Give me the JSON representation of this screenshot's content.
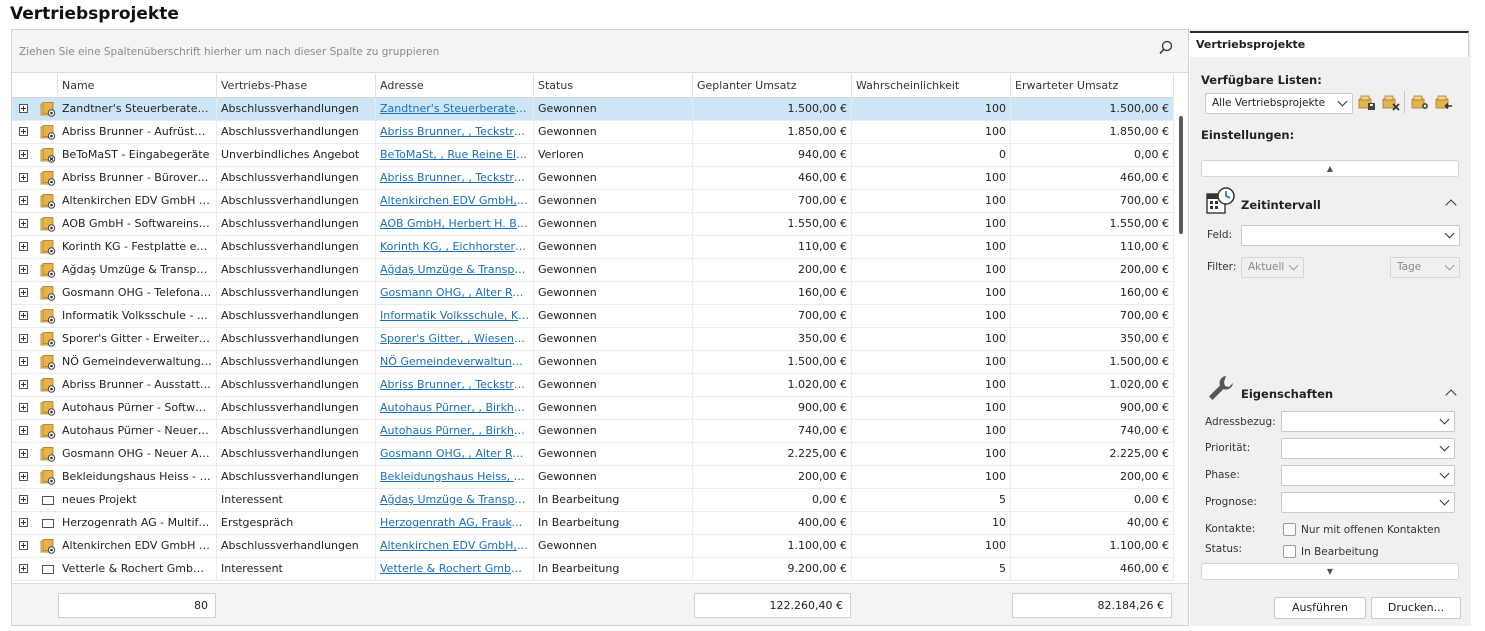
{
  "page": {
    "title": "Vertriebsprojekte"
  },
  "grid": {
    "group_hint": "Ziehen Sie eine Spaltenüberschrift hierher um nach dieser Spalte zu gruppieren",
    "columns": [
      "Name",
      "Vertriebs-Phase",
      "Adresse",
      "Status",
      "Geplanter Umsatz",
      "Wahrscheinlichkeit",
      "Erwarteter Umsatz"
    ],
    "rows": [
      {
        "icon": "project",
        "name": "Zandtner's Steuerberater - D...",
        "phase": "Abschlussverhandlungen",
        "address": "Zandtner's Steuerberater, Lé...",
        "status": "Gewonnen",
        "planned": "1.500,00 €",
        "probability": "100",
        "expected": "1.500,00 €",
        "selected": true
      },
      {
        "icon": "project",
        "name": "Abriss Brunner - Aufrüstung ...",
        "phase": "Abschlussverhandlungen",
        "address": "Abriss Brunner, , Teckstraße...",
        "status": "Gewonnen",
        "planned": "1.850,00 €",
        "probability": "100",
        "expected": "1.850,00 €"
      },
      {
        "icon": "project-lost",
        "name": "BeToMaST - Eingabegeräte",
        "phase": "Unverbindliches Angebot",
        "address": "BeToMaSt, , Rue Reine Elisa...",
        "status": "Verloren",
        "planned": "940,00 €",
        "probability": "0",
        "expected": "0,00 €"
      },
      {
        "icon": "project",
        "name": "Abriss Brunner - Bürovergröß...",
        "phase": "Abschlussverhandlungen",
        "address": "Abriss Brunner, , Teckstraße...",
        "status": "Gewonnen",
        "planned": "460,00 €",
        "probability": "100",
        "expected": "460,00 €"
      },
      {
        "icon": "project",
        "name": "Altenkirchen EDV GmbH - Mo...",
        "phase": "Abschlussverhandlungen",
        "address": "Altenkirchen EDV GmbH, Karl ...",
        "status": "Gewonnen",
        "planned": "700,00 €",
        "probability": "100",
        "expected": "700,00 €"
      },
      {
        "icon": "project",
        "name": "AOB GmbH - Softwareinstalla...",
        "phase": "Abschlussverhandlungen",
        "address": "AOB GmbH, Herbert H. Blauh...",
        "status": "Gewonnen",
        "planned": "1.550,00 €",
        "probability": "100",
        "expected": "1.550,00 €"
      },
      {
        "icon": "project",
        "name": "Korinth KG - Festplatte extern",
        "phase": "Abschlussverhandlungen",
        "address": "Korinth KG, , Eichhorster We...",
        "status": "Gewonnen",
        "planned": "110,00 €",
        "probability": "100",
        "expected": "110,00 €"
      },
      {
        "icon": "project",
        "name": "Ağdaş Umzüge & Transporte ...",
        "phase": "Abschlussverhandlungen",
        "address": "Ağdaş Umzüge & Transporte,...",
        "status": "Gewonnen",
        "planned": "200,00 €",
        "probability": "100",
        "expected": "200,00 €"
      },
      {
        "icon": "project",
        "name": "Gosmann OHG - Telefonanlag...",
        "phase": "Abschlussverhandlungen",
        "address": "Gosmann OHG, , Alter Ratha...",
        "status": "Gewonnen",
        "planned": "160,00 €",
        "probability": "100",
        "expected": "160,00 €"
      },
      {
        "icon": "project",
        "name": "Informatik Volksschule - Neue...",
        "phase": "Abschlussverhandlungen",
        "address": "Informatik Volksschule, Karl F...",
        "status": "Gewonnen",
        "planned": "700,00 €",
        "probability": "100",
        "expected": "700,00 €"
      },
      {
        "icon": "project",
        "name": "Sporer's Gitter - Erweiterung ...",
        "phase": "Abschlussverhandlungen",
        "address": "Sporer's Gitter, , Wiesengru...",
        "status": "Gewonnen",
        "planned": "350,00 €",
        "probability": "100",
        "expected": "350,00 €"
      },
      {
        "icon": "project",
        "name": "NÖ Gemeindeverwaltungssch...",
        "phase": "Abschlussverhandlungen",
        "address": "NÖ Gemeindeverwaltungssch...",
        "status": "Gewonnen",
        "planned": "1.500,00 €",
        "probability": "100",
        "expected": "1.500,00 €"
      },
      {
        "icon": "project",
        "name": "Abriss Brunner - Ausstattung...",
        "phase": "Abschlussverhandlungen",
        "address": "Abriss Brunner, , Teckstraße...",
        "status": "Gewonnen",
        "planned": "1.020,00 €",
        "probability": "100",
        "expected": "1.020,00 €"
      },
      {
        "icon": "project",
        "name": "Autohaus Pürner - Software ...",
        "phase": "Abschlussverhandlungen",
        "address": "Autohaus Pürner, , Birkhahn...",
        "status": "Gewonnen",
        "planned": "900,00 €",
        "probability": "100",
        "expected": "900,00 €"
      },
      {
        "icon": "project",
        "name": "Autohaus Pürner - Neuer Client",
        "phase": "Abschlussverhandlungen",
        "address": "Autohaus Pürner, , Birkhahn...",
        "status": "Gewonnen",
        "planned": "740,00 €",
        "probability": "100",
        "expected": "740,00 €"
      },
      {
        "icon": "project",
        "name": "Gosmann OHG - Neuer Arbeit...",
        "phase": "Abschlussverhandlungen",
        "address": "Gosmann OHG, , Alter Ratha...",
        "status": "Gewonnen",
        "planned": "2.225,00 €",
        "probability": "100",
        "expected": "2.225,00 €"
      },
      {
        "icon": "project",
        "name": "Bekleidungshaus Heiss - Tablet",
        "phase": "Abschlussverhandlungen",
        "address": "Bekleidungshaus Heiss, Anto...",
        "status": "Gewonnen",
        "planned": "200,00 €",
        "probability": "100",
        "expected": "200,00 €"
      },
      {
        "icon": "empty",
        "name": "neues Projekt",
        "phase": "Interessent",
        "address": "Ağdaş Umzüge & Transporte,...",
        "status": "In Bearbeitung",
        "planned": "0,00 €",
        "probability": "5",
        "expected": "0,00 €"
      },
      {
        "icon": "empty",
        "name": "Herzogenrath AG - Multifunkt...",
        "phase": "Erstgespräch",
        "address": "Herzogenrath AG, Frauke Sc...",
        "status": "In Bearbeitung",
        "planned": "400,00 €",
        "probability": "10",
        "expected": "40,00 €"
      },
      {
        "icon": "project",
        "name": "Altenkirchen EDV GmbH - Sof...",
        "phase": "Abschlussverhandlungen",
        "address": "Altenkirchen EDV GmbH, Karl ...",
        "status": "Gewonnen",
        "planned": "1.100,00 €",
        "probability": "100",
        "expected": "1.100,00 €"
      },
      {
        "icon": "empty",
        "name": "Vetterle & Rochert GmbH - O...",
        "phase": "Interessent",
        "address": "Vetterle & Rochert GmbH, W...",
        "status": "In Bearbeitung",
        "planned": "9.200,00 €",
        "probability": "5",
        "expected": "460,00 €"
      }
    ],
    "summary": {
      "count": "80",
      "planned_total": "122.260,40 €",
      "expected_total": "82.184,26 €"
    }
  },
  "side_panel": {
    "tab_label": "Vertriebsprojekte",
    "available_lists_label": "Verfügbare Listen:",
    "selected_list": "Alle Vertriebsprojekte",
    "settings_label": "Einstellungen:",
    "scroll_up": "▲",
    "scroll_down": "▼",
    "time_interval": {
      "title": "Zeitintervall",
      "field_label": "Feld:",
      "field_value": "",
      "filter_label": "Filter:",
      "filter_value": "Aktuell",
      "unit_value": "Tage"
    },
    "properties": {
      "title": "Eigenschaften",
      "address_ref_label": "Adressbezug:",
      "priority_label": "Priorität:",
      "phase_label": "Phase:",
      "forecast_label": "Prognose:",
      "contacts_label": "Kontakte:",
      "contacts_checkbox": "Nur mit offenen Kontakten",
      "status_label": "Status:",
      "status_checkbox": "In Bearbeitung"
    },
    "buttons": {
      "run": "Ausführen",
      "print": "Drucken..."
    }
  },
  "colors": {
    "selection": "#cde6f7",
    "link": "#1a6fb8",
    "icon_gold": "#d9a441"
  }
}
